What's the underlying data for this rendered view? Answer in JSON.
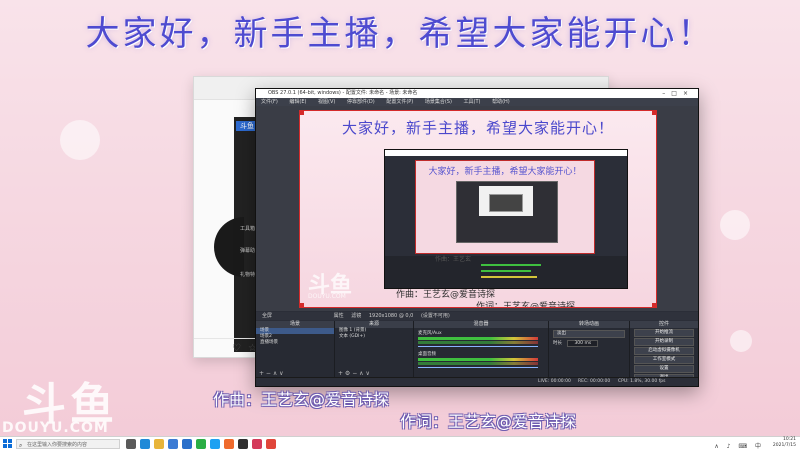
{
  "banner": "大家好，新手主播，希望大家能开心！",
  "back_window": {
    "brand": "斗鱼",
    "sidebar_labels": [
      "工具箱",
      "弹幕助手",
      "礼物特效"
    ],
    "footer_icons": [
      "♡",
      "☆",
      "⊙"
    ]
  },
  "obs": {
    "title": "OBS 27.0.1 (64-bit, windows) - 配置文件: 未命名 - 场景: 未命名",
    "menu": [
      "文件(F)",
      "编辑(E)",
      "视图(V)",
      "停靠部件(D)",
      "配置文件(P)",
      "场景集合(S)",
      "工具(T)",
      "帮助(H)"
    ],
    "canvas_banner": "大家好，新手主播，希望大家能开心！",
    "nested_banner": "大家好，新手主播，希望大家能开心！",
    "canvas_watermark": "斗鱼",
    "canvas_watermark_url": "DOUYU.COM",
    "canvas_credit_composer": "作曲：王艺玄@爱音诗探",
    "canvas_credit_lyric": "作词：王艺玄@爱音诗探",
    "nested_credit": "作曲：王艺玄",
    "status_label": "全屏",
    "status_tabs": [
      "属性",
      "滤镜"
    ],
    "status_source": "1920x1080 @ 0,0",
    "status_value": "(设置不可用)",
    "docks": {
      "scenes": {
        "title": "场景",
        "items": [
          "场景",
          "场景2",
          "直播场景"
        ],
        "selected": 0,
        "footer": "+ − ∧ ∨"
      },
      "sources": {
        "title": "来源",
        "items": [
          "图像 1 (背景)",
          "文本 (GDI+)"
        ],
        "footer": "+ ⚙ − ∧ ∨"
      },
      "mixer": {
        "title": "混音器",
        "channels": [
          {
            "label": "麦克风/Aux",
            "level": 0.78
          },
          {
            "label": "桌面音频",
            "level": 0.62
          }
        ]
      },
      "transitions": {
        "title": "转场动画",
        "type": "淡出",
        "duration_label": "时长",
        "duration": "300 ms"
      },
      "controls": {
        "title": "控件",
        "buttons": [
          "开始推流",
          "开始录制",
          "启动虚拟摄像机",
          "工作室模式",
          "设置",
          "退出"
        ]
      }
    },
    "status_bar": {
      "live": "LIVE: 00:00:00",
      "rec": "REC: 00:00:00",
      "cpu": "CPU: 1.8%, 30.00 fps"
    }
  },
  "credit_composer": "作曲：王艺玄@爱音诗探",
  "credit_lyric": "作词：王艺玄@爱音诗探",
  "watermark": {
    "logo": "斗鱼",
    "url": "DOUYU.COM"
  },
  "taskbar": {
    "search_placeholder": "在这里输入你要搜索的内容",
    "apps": [
      {
        "name": "task-view-icon",
        "color": "#5a5a5a"
      },
      {
        "name": "edge-icon",
        "color": "#1f8ad8"
      },
      {
        "name": "file-explorer-icon",
        "color": "#e8b53a"
      },
      {
        "name": "store-icon",
        "color": "#3b7bd4"
      },
      {
        "name": "mail-icon",
        "color": "#2a6fca"
      },
      {
        "name": "wechat-icon",
        "color": "#2aae45"
      },
      {
        "name": "qq-icon",
        "color": "#1da1f2"
      },
      {
        "name": "douyu-icon",
        "color": "#ef6a2c"
      },
      {
        "name": "obs-icon",
        "color": "#2f2f2f"
      },
      {
        "name": "music-icon",
        "color": "#d43a5a"
      },
      {
        "name": "chrome-icon",
        "color": "#e0463a"
      }
    ],
    "tray_symbols": "∧ ♪ ⌨ 中",
    "time": "10:21",
    "date": "2021/7/15"
  }
}
